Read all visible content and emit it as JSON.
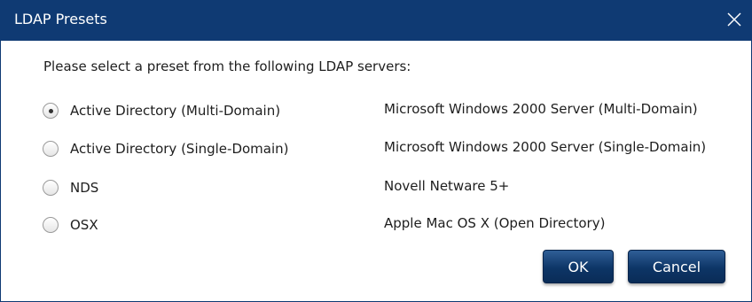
{
  "dialog": {
    "title": "LDAP Presets",
    "prompt": "Please select a preset from the following LDAP servers:",
    "close_icon": "close-icon"
  },
  "options": [
    {
      "label": "Active Directory (Multi-Domain)",
      "description": "Microsoft Windows 2000 Server (Multi-Domain)",
      "selected": true
    },
    {
      "label": "Active Directory (Single-Domain)",
      "description": "Microsoft Windows 2000 Server (Single-Domain)",
      "selected": false
    },
    {
      "label": "NDS",
      "description": "Novell Netware 5+",
      "selected": false
    },
    {
      "label": "OSX",
      "description": "Apple Mac OS X (Open Directory)",
      "selected": false
    }
  ],
  "buttons": {
    "ok_label": "OK",
    "cancel_label": "Cancel"
  },
  "colors": {
    "titlebar": "#0f3a73",
    "button": "#0d3566"
  }
}
